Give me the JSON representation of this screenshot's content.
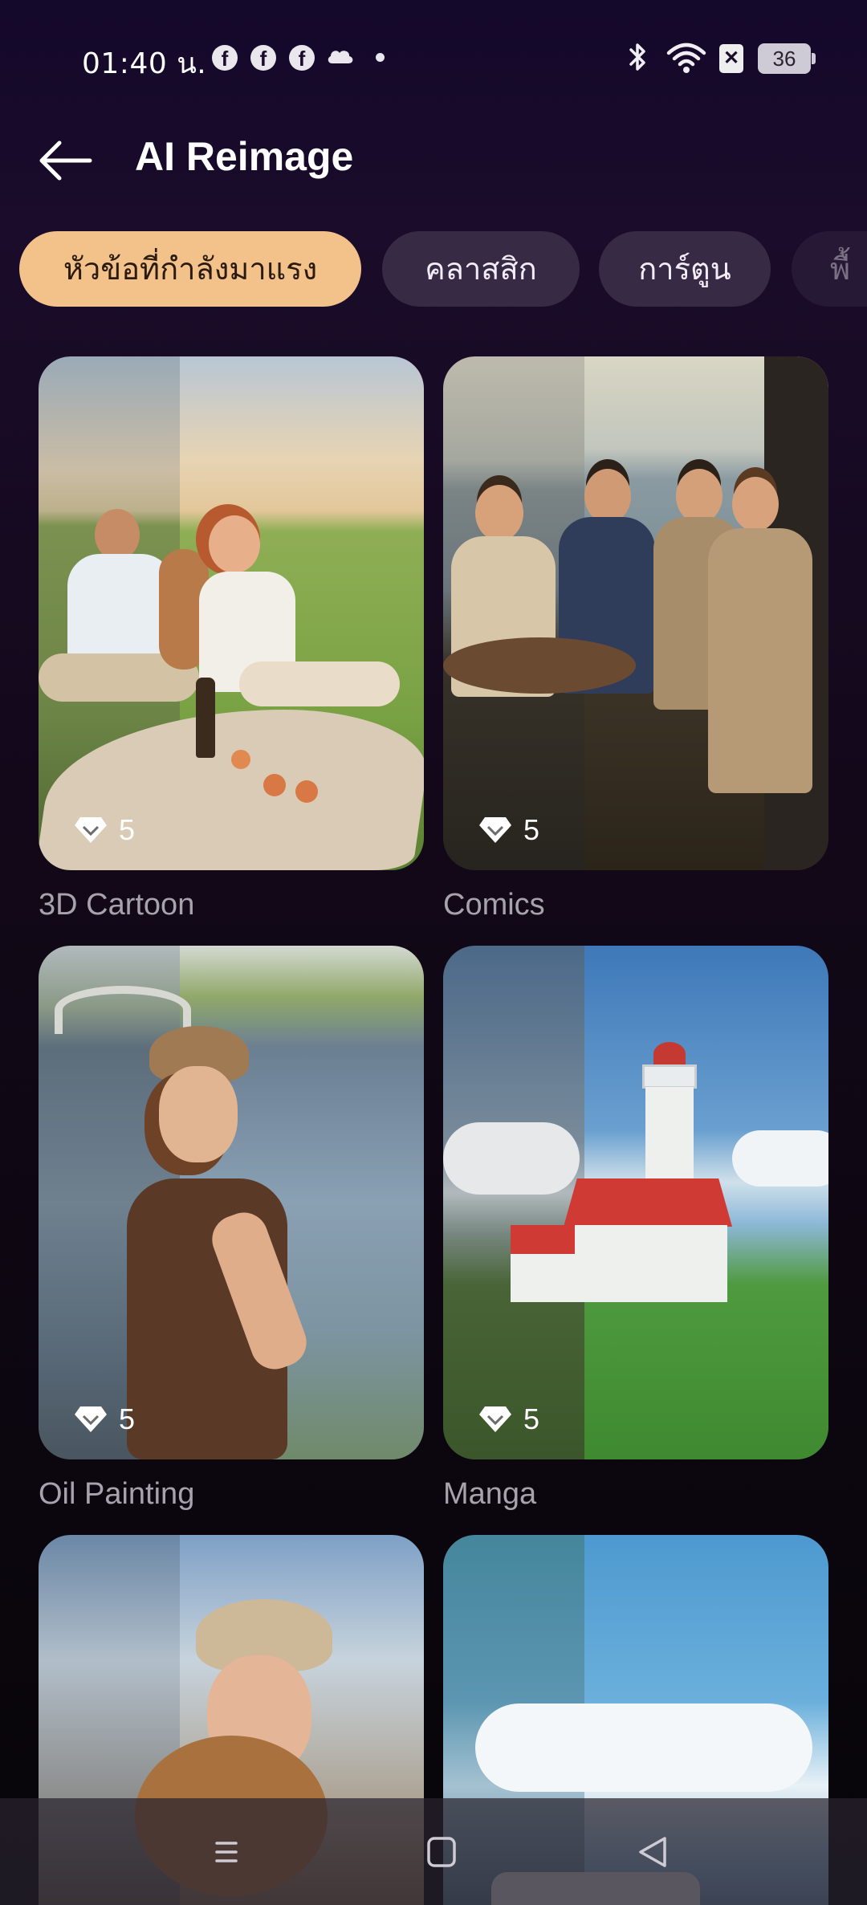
{
  "status_bar": {
    "time": "01:40 น.",
    "notification_icons": [
      "facebook-icon",
      "facebook-icon",
      "facebook-icon",
      "cloud-icon",
      "dot-icon"
    ],
    "system_icons": [
      "bluetooth-icon",
      "wifi-icon",
      "no-sim-icon",
      "battery-icon"
    ],
    "battery_level": "36"
  },
  "header": {
    "title": "AI Reimage",
    "back_icon": "arrow-left-icon"
  },
  "tabs": [
    {
      "label": "หัวข้อที่กำลังมาแรง",
      "active": true
    },
    {
      "label": "คลาสสิก",
      "active": false
    },
    {
      "label": "การ์ตูน",
      "active": false
    },
    {
      "label": "พื้",
      "active": false
    }
  ],
  "cards": [
    {
      "label": "3D Cartoon",
      "cost": "5",
      "cost_icon": "diamond-icon"
    },
    {
      "label": "Comics",
      "cost": "5",
      "cost_icon": "diamond-icon"
    },
    {
      "label": "Oil Painting",
      "cost": "5",
      "cost_icon": "diamond-icon"
    },
    {
      "label": "Manga",
      "cost": "5",
      "cost_icon": "diamond-icon"
    },
    {
      "label": "",
      "cost": "",
      "cost_icon": ""
    },
    {
      "label": "",
      "cost": "",
      "cost_icon": ""
    }
  ],
  "navbar": {
    "icons": [
      "menu-icon",
      "home-square-icon",
      "back-triangle-icon"
    ]
  },
  "colors": {
    "accent_tab": "#f3c28b",
    "tab_bg": "#372a45",
    "label_text": "#a7a3ad",
    "background": "#14082b"
  }
}
